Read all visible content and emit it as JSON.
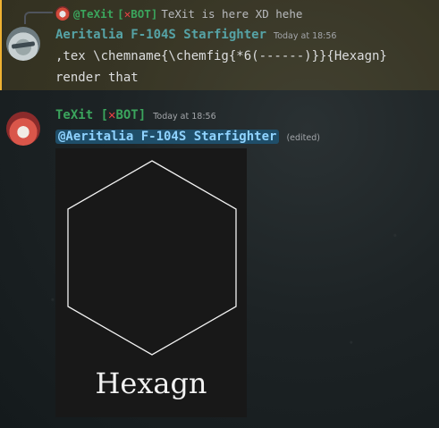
{
  "reply": {
    "mention": "@TeXit",
    "bot_badge_icon": "✕",
    "bot_badge_label": "BOT",
    "text": "TeXit is here XD hehe"
  },
  "messages": [
    {
      "author": "Aeritalia F-104S Starfighter",
      "timestamp": "Today at 18:56",
      "lines": [
        ",tex \\chemname{\\chemfig{*6(------)}}{Hexagn}",
        "render that"
      ]
    },
    {
      "author": "TeXit",
      "bot_badge_icon": "✕",
      "bot_badge_label": "BOT",
      "timestamp": "Today at 18:56",
      "mention": "@Aeritalia F-104S Starfighter",
      "edited": "(edited)",
      "rendered_caption": "Hexagn"
    }
  ],
  "colors": {
    "highlight": "#f0b232",
    "bot_green": "#3ba55d",
    "bot_x_red": "#ed4245",
    "author_blue": "#56a3a6"
  }
}
